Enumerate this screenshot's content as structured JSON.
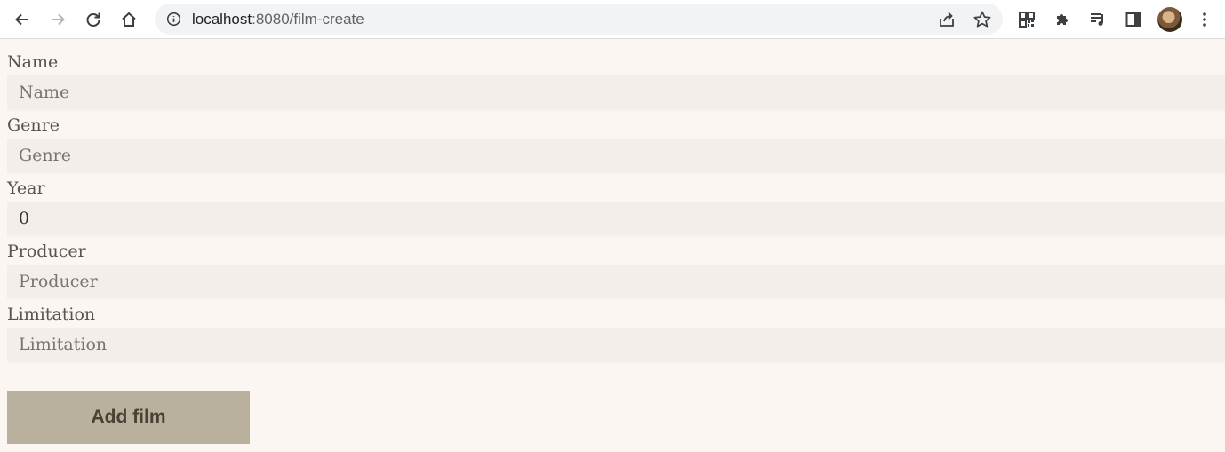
{
  "browser": {
    "url_host": "localhost",
    "url_path": ":8080/film-create"
  },
  "form": {
    "fields": [
      {
        "label": "Name",
        "placeholder": "Name",
        "value": ""
      },
      {
        "label": "Genre",
        "placeholder": "Genre",
        "value": ""
      },
      {
        "label": "Year",
        "placeholder": "",
        "value": "0"
      },
      {
        "label": "Producer",
        "placeholder": "Producer",
        "value": ""
      },
      {
        "label": "Limitation",
        "placeholder": "Limitation",
        "value": ""
      }
    ],
    "submit_label": "Add film"
  }
}
